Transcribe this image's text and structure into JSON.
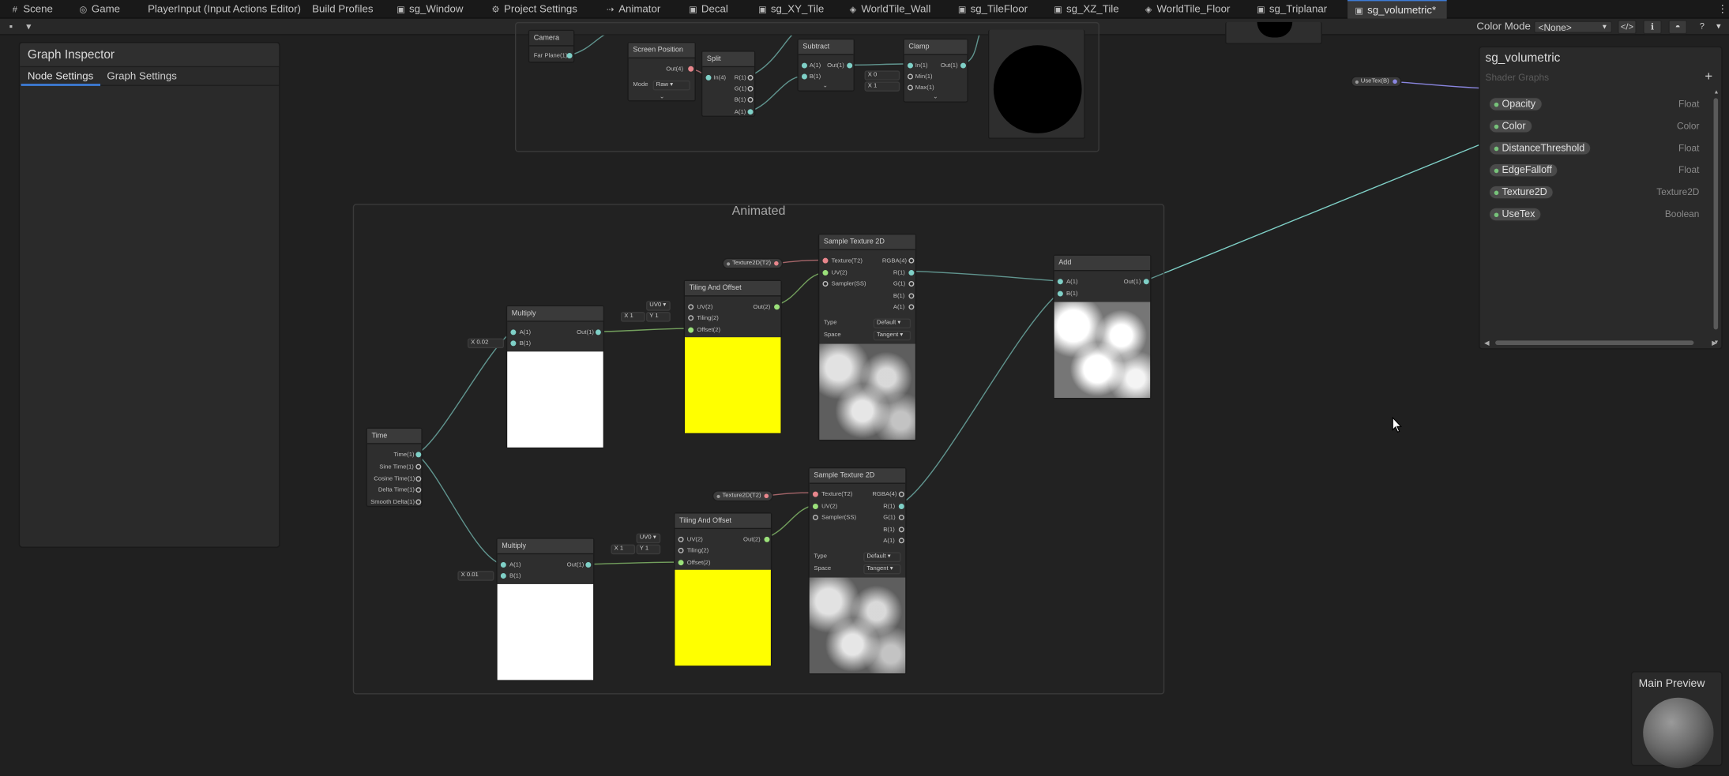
{
  "tabs": [
    {
      "label": "Scene",
      "icon": "grid-icon",
      "active": false
    },
    {
      "label": "Game",
      "icon": "gamepad-icon",
      "active": false
    },
    {
      "label": "PlayerInput (Input Actions Editor)",
      "icon": "",
      "active": false
    },
    {
      "label": "Build Profiles",
      "icon": "",
      "active": false
    },
    {
      "label": "sg_Window",
      "icon": "shader-graph-icon",
      "active": false
    },
    {
      "label": "Project Settings",
      "icon": "gear-icon",
      "active": false
    },
    {
      "label": "Animator",
      "icon": "animator-icon",
      "active": false
    },
    {
      "label": "Decal",
      "icon": "shader-graph-icon",
      "active": false
    },
    {
      "label": "sg_XY_Tile",
      "icon": "shader-graph-icon",
      "active": false
    },
    {
      "label": "WorldTile_Wall",
      "icon": "vfx-graph-icon",
      "active": false
    },
    {
      "label": "sg_TileFloor",
      "icon": "shader-graph-icon",
      "active": false
    },
    {
      "label": "sg_XZ_Tile",
      "icon": "shader-graph-icon",
      "active": false
    },
    {
      "label": "WorldTile_Floor",
      "icon": "vfx-graph-icon",
      "active": false
    },
    {
      "label": "sg_Triplanar",
      "icon": "shader-graph-icon",
      "active": false
    },
    {
      "label": "sg_volumetric*",
      "icon": "shader-graph-icon",
      "active": true
    }
  ],
  "toolbar": {
    "color_mode_label": "Color Mode",
    "color_mode_value": "<None>"
  },
  "inspector": {
    "title": "Graph Inspector",
    "tabs": [
      "Node Settings",
      "Graph Settings"
    ]
  },
  "top_group": {
    "nodes": {
      "camera": {
        "title": "Camera",
        "port": "Far Plane(1)"
      },
      "screen_position": {
        "title": "Screen Position",
        "port": "Out(4)",
        "mode_label": "Mode",
        "mode_value": "Raw"
      },
      "split": {
        "title": "Split",
        "in": "In(4)",
        "outs": [
          "R(1)",
          "G(1)",
          "B(1)",
          "A(1)"
        ]
      },
      "subtract": {
        "title": "Subtract",
        "ins": [
          "A(1)",
          "B(1)"
        ],
        "out": "Out(1)"
      },
      "clamp": {
        "title": "Clamp",
        "ins": [
          "In(1)",
          "Min(1)",
          "Max(1)"
        ],
        "out": "Out(1)",
        "min_field": "X  0",
        "max_field": "X  1"
      }
    }
  },
  "usetex_pill": "UseTex(B)",
  "group": {
    "title": "Animated",
    "nodes": {
      "time": {
        "title": "Time",
        "ports": [
          "Time(1)",
          "Sine Time(1)",
          "Cosine Time(1)",
          "Delta Time(1)",
          "Smooth Delta(1)"
        ]
      },
      "multiply_a": {
        "title": "Multiply",
        "ins": [
          "A(1)",
          "B(1)"
        ],
        "out": "Out(1)",
        "field": "X  0.02"
      },
      "multiply_b": {
        "title": "Multiply",
        "ins": [
          "A(1)",
          "B(1)"
        ],
        "out": "Out(1)",
        "field": "X  0.01"
      },
      "tiling_a": {
        "title": "Tiling And Offset",
        "ins": [
          "UV(2)",
          "Tiling(2)",
          "Offset(2)"
        ],
        "out": "Out(2)",
        "uv_field": "UV0",
        "tiling_x": "X  1",
        "tiling_y": "Y  1"
      },
      "tiling_b": {
        "title": "Tiling And Offset",
        "ins": [
          "UV(2)",
          "Tiling(2)",
          "Offset(2)"
        ],
        "out": "Out(2)",
        "uv_field": "UV0",
        "tiling_x": "X  1",
        "tiling_y": "Y  1"
      },
      "sample_a": {
        "title": "Sample Texture 2D",
        "ins": [
          "Texture(T2)",
          "UV(2)",
          "Sampler(SS)"
        ],
        "outs": [
          "RGBA(4)",
          "R(1)",
          "G(1)",
          "B(1)",
          "A(1)"
        ],
        "type_label": "Type",
        "type_value": "Default",
        "space_label": "Space",
        "space_value": "Tangent"
      },
      "sample_b": {
        "title": "Sample Texture 2D",
        "ins": [
          "Texture(T2)",
          "UV(2)",
          "Sampler(SS)"
        ],
        "outs": [
          "RGBA(4)",
          "R(1)",
          "G(1)",
          "B(1)",
          "A(1)"
        ],
        "type_label": "Type",
        "type_value": "Default",
        "space_label": "Space",
        "space_value": "Tangent"
      },
      "add": {
        "title": "Add",
        "ins": [
          "A(1)",
          "B(1)"
        ],
        "out": "Out(1)"
      }
    },
    "texture_pill_a": "Texture2D(T2)",
    "texture_pill_b": "Texture2D(T2)"
  },
  "blackboard": {
    "title": "sg_volumetric",
    "subtitle": "Shader Graphs",
    "add_label": "+",
    "properties": [
      {
        "name": "Opacity",
        "type": "Float"
      },
      {
        "name": "Color",
        "type": "Color"
      },
      {
        "name": "DistanceThreshold",
        "type": "Float"
      },
      {
        "name": "EdgeFalloff",
        "type": "Float"
      },
      {
        "name": "Texture2D",
        "type": "Texture2D"
      },
      {
        "name": "UseTex",
        "type": "Boolean"
      }
    ]
  },
  "main_preview": {
    "title": "Main Preview"
  },
  "colors": {
    "accent": "#3d7bd6",
    "wire_float": "#7fd0c7",
    "wire_vector2": "#9be17a",
    "wire_texture": "#e8868c",
    "wire_boolean": "#8a86e0",
    "yellow_preview": "#ffff00",
    "white_preview": "#ffffff"
  }
}
